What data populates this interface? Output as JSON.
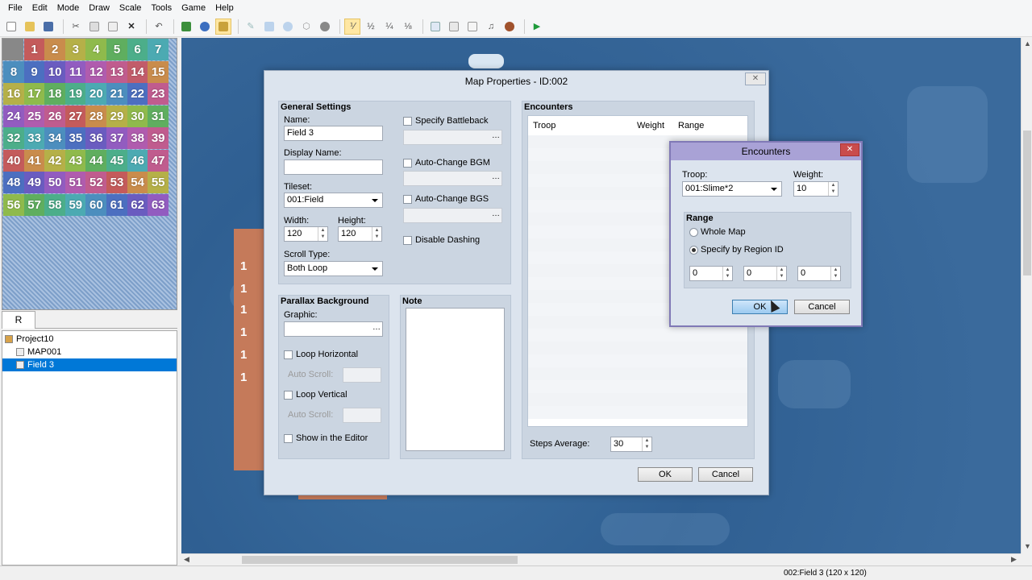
{
  "menu": [
    "File",
    "Edit",
    "Mode",
    "Draw",
    "Scale",
    "Tools",
    "Game",
    "Help"
  ],
  "palette_tiles": [
    {
      "n": "1",
      "c": "#c45b5b"
    },
    {
      "n": "2",
      "c": "#c98c4c"
    },
    {
      "n": "3",
      "c": "#b5b048"
    },
    {
      "n": "4",
      "c": "#8fba4c"
    },
    {
      "n": "5",
      "c": "#5fae5f"
    },
    {
      "n": "6",
      "c": "#4cae8a"
    },
    {
      "n": "7",
      "c": "#4caab2"
    },
    {
      "n": "8",
      "c": "#4c8ebe"
    },
    {
      "n": "9",
      "c": "#4c6fc0"
    },
    {
      "n": "10",
      "c": "#6a5cc0"
    },
    {
      "n": "11",
      "c": "#925cc0"
    },
    {
      "n": "12",
      "c": "#b05cae"
    },
    {
      "n": "13",
      "c": "#c05c8e"
    },
    {
      "n": "14",
      "c": "#c25c6a"
    },
    {
      "n": "15",
      "c": "#c98c4c"
    },
    {
      "n": "16",
      "c": "#b5b048"
    },
    {
      "n": "17",
      "c": "#8fba4c"
    },
    {
      "n": "18",
      "c": "#5fae5f"
    },
    {
      "n": "19",
      "c": "#4cae8a"
    },
    {
      "n": "20",
      "c": "#4caab2"
    },
    {
      "n": "21",
      "c": "#4c8ebe"
    },
    {
      "n": "22",
      "c": "#4c6fc0"
    },
    {
      "n": "23",
      "c": "#c05c8e"
    },
    {
      "n": "24",
      "c": "#925cc0"
    },
    {
      "n": "25",
      "c": "#b05cae"
    },
    {
      "n": "26",
      "c": "#c05c8e"
    },
    {
      "n": "27",
      "c": "#c45b5b"
    },
    {
      "n": "28",
      "c": "#c98c4c"
    },
    {
      "n": "29",
      "c": "#b5b048"
    },
    {
      "n": "30",
      "c": "#8fba4c"
    },
    {
      "n": "31",
      "c": "#5fae5f"
    },
    {
      "n": "32",
      "c": "#4cae8a"
    },
    {
      "n": "33",
      "c": "#4caab2"
    },
    {
      "n": "34",
      "c": "#4c8ebe"
    },
    {
      "n": "35",
      "c": "#4c6fc0"
    },
    {
      "n": "36",
      "c": "#6a5cc0"
    },
    {
      "n": "37",
      "c": "#925cc0"
    },
    {
      "n": "38",
      "c": "#b05cae"
    },
    {
      "n": "39",
      "c": "#c05c8e"
    },
    {
      "n": "40",
      "c": "#c45b5b"
    },
    {
      "n": "41",
      "c": "#c98c4c"
    },
    {
      "n": "42",
      "c": "#b5b048"
    },
    {
      "n": "43",
      "c": "#8fba4c"
    },
    {
      "n": "44",
      "c": "#5fae5f"
    },
    {
      "n": "45",
      "c": "#4cae8a"
    },
    {
      "n": "46",
      "c": "#4caab2"
    },
    {
      "n": "47",
      "c": "#c05c8e"
    },
    {
      "n": "48",
      "c": "#4c6fc0"
    },
    {
      "n": "49",
      "c": "#6a5cc0"
    },
    {
      "n": "50",
      "c": "#925cc0"
    },
    {
      "n": "51",
      "c": "#b05cae"
    },
    {
      "n": "52",
      "c": "#c05c8e"
    },
    {
      "n": "53",
      "c": "#c45b5b"
    },
    {
      "n": "54",
      "c": "#c98c4c"
    },
    {
      "n": "55",
      "c": "#b5b048"
    },
    {
      "n": "56",
      "c": "#8fba4c"
    },
    {
      "n": "57",
      "c": "#5fae5f"
    },
    {
      "n": "58",
      "c": "#4cae8a"
    },
    {
      "n": "59",
      "c": "#4caab2"
    },
    {
      "n": "60",
      "c": "#4c8ebe"
    },
    {
      "n": "61",
      "c": "#4c6fc0"
    },
    {
      "n": "62",
      "c": "#6a5cc0"
    },
    {
      "n": "63",
      "c": "#925cc0"
    }
  ],
  "region_tab": "R",
  "tree": [
    {
      "label": "Project10",
      "selected": false,
      "indent": 0
    },
    {
      "label": "MAP001",
      "selected": false,
      "indent": 1
    },
    {
      "label": "Field 3",
      "selected": true,
      "indent": 1
    }
  ],
  "map_region_labels": [
    "1",
    "1",
    "1",
    "1",
    "1",
    "1"
  ],
  "status": "002:Field 3 (120 x 120)",
  "map_props": {
    "title": "Map Properties - ID:002",
    "general": "General Settings",
    "name_label": "Name:",
    "name_value": "Field 3",
    "display_name_label": "Display Name:",
    "display_name_value": "",
    "tileset_label": "Tileset:",
    "tileset_value": "001:Field",
    "width_label": "Width:",
    "width_value": "120",
    "height_label": "Height:",
    "height_value": "120",
    "scroll_label": "Scroll Type:",
    "scroll_value": "Both Loop",
    "specify_battleback": "Specify Battleback",
    "auto_bgm": "Auto-Change BGM",
    "auto_bgs": "Auto-Change BGS",
    "disable_dashing": "Disable Dashing",
    "parallax": "Parallax Background",
    "graphic_label": "Graphic:",
    "loop_h": "Loop Horizontal",
    "auto_scroll_1": "Auto Scroll:",
    "loop_v": "Loop Vertical",
    "auto_scroll_2": "Auto Scroll:",
    "show_editor": "Show in the Editor",
    "note": "Note",
    "encounters": "Encounters",
    "col_troop": "Troop",
    "col_weight": "Weight",
    "col_range": "Range",
    "steps_label": "Steps Average:",
    "steps_value": "30",
    "ok": "OK",
    "cancel": "Cancel"
  },
  "enc_dialog": {
    "title": "Encounters",
    "troop_label": "Troop:",
    "troop_value": "001:Slime*2",
    "weight_label": "Weight:",
    "weight_value": "10",
    "range": "Range",
    "whole_map": "Whole Map",
    "specify_region": "Specify by Region ID",
    "region_ids": [
      "0",
      "0",
      "0"
    ],
    "ok": "OK",
    "cancel": "Cancel"
  }
}
